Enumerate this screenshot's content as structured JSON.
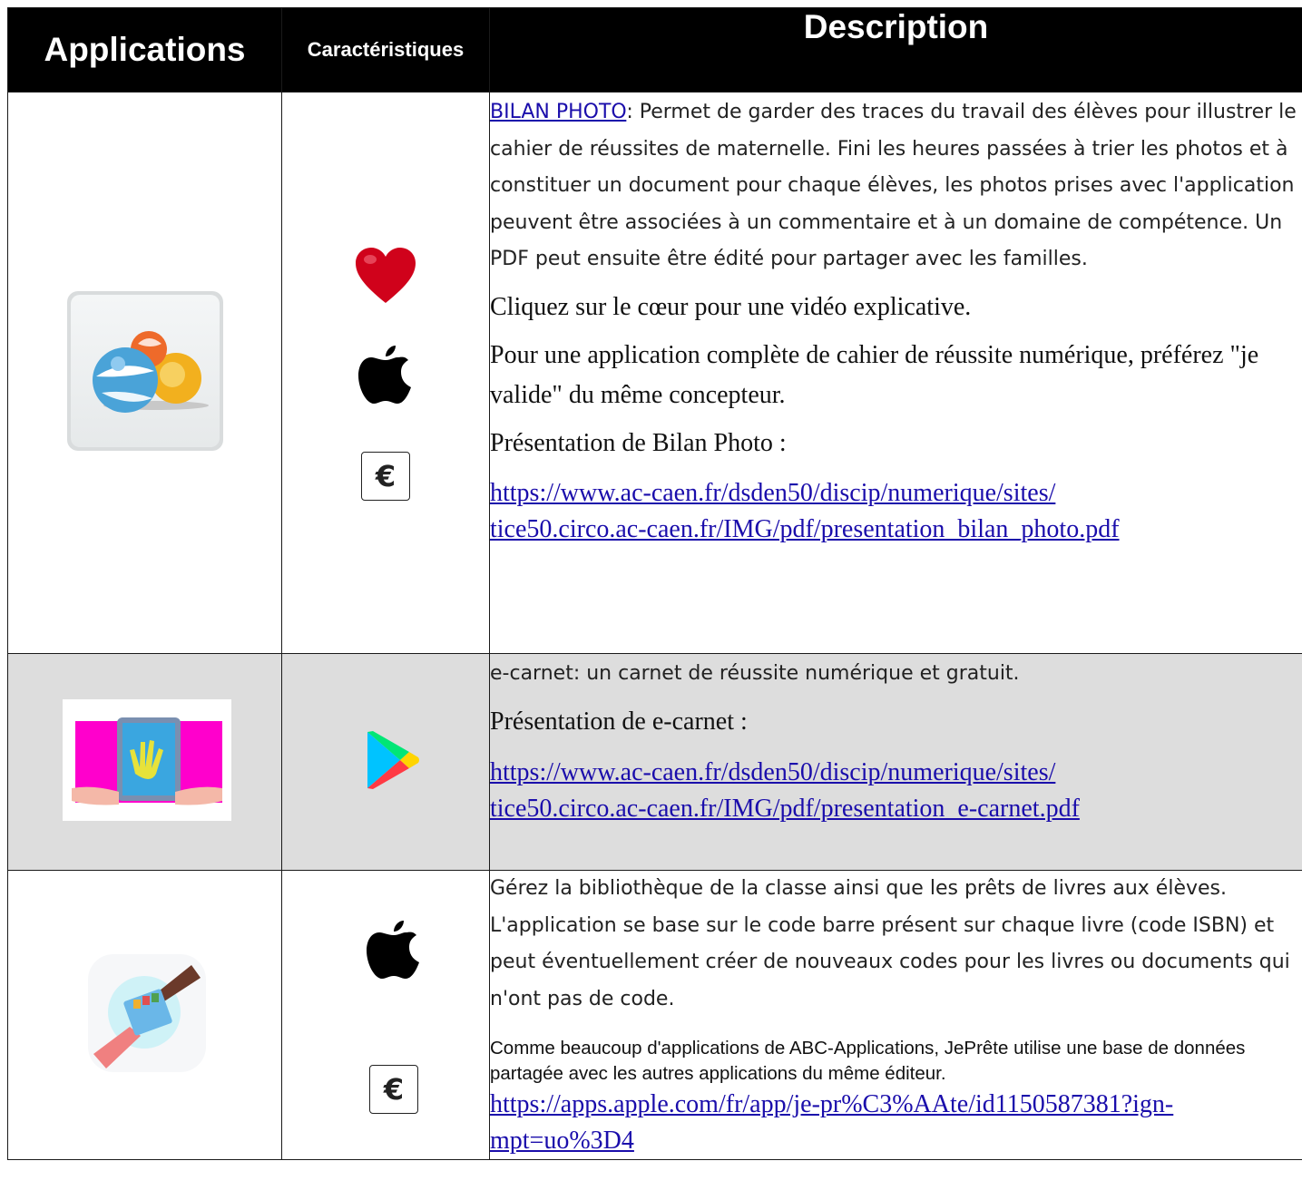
{
  "header": {
    "applications": "Applications",
    "caracteristiques": "Caractéristiques",
    "description": "Description"
  },
  "rows": [
    {
      "app_icon": "bilan-photo-app-icon",
      "characteristics": [
        "heart-icon",
        "apple-icon",
        "euro-icon"
      ],
      "euro_label": "€",
      "link_label": "BILAN PHOTO",
      "paragraph1": ": Permet de garder des traces du travail des élèves pour illustrer le cahier de réussites de maternelle. Fini les heures passées à trier les photos et à constituer un document pour chaque élèves, les photos prises avec l'application peuvent être associées à un commentaire et à un domaine de compétence. Un PDF peut ensuite être édité pour partager avec les familles.",
      "paragraph2": "Cliquez sur le cœur pour une vidéo explicative.",
      "paragraph3": "Pour une application complète de cahier de réussite numérique, préférez \"je valide\" du même concepteur.",
      "paragraph4": "Présentation de Bilan Photo :",
      "url_line1": "https://www.ac-caen.fr/dsden50/discip/numerique/sites/",
      "url_line2": "tice50.circo.ac-caen.fr/IMG/pdf/presentation_bilan_photo.pdf"
    },
    {
      "app_icon": "e-carnet-app-icon",
      "characteristics": [
        "google-play-icon"
      ],
      "paragraph1": "e-carnet: un carnet de réussite numérique et gratuit.",
      "paragraph2": "Présentation de e-carnet :",
      "url_line1": "https://www.ac-caen.fr/dsden50/discip/numerique/sites/",
      "url_line2": "tice50.circo.ac-caen.fr/IMG/pdf/presentation_e-carnet.pdf"
    },
    {
      "app_icon": "jeprete-app-icon",
      "characteristics": [
        "apple-icon",
        "euro-icon"
      ],
      "euro_label": "€",
      "paragraph1": "Gérez la bibliothèque de la classe ainsi que les prêts de livres aux élèves. L'application se base sur le code barre présent sur chaque livre (code ISBN) et peut éventuellement créer de nouveaux codes pour les livres ou documents qui n'ont pas de code.",
      "paragraph2": "Comme beaucoup d'applications de ABC-Applications, JePrête utilise une base de données partagée avec les autres applications du même éditeur.",
      "url_line1": "https://apps.apple.com/fr/app/je-pr%C3%AAte/id1150587381?ign-",
      "url_line2": "mpt=uo%3D4"
    }
  ],
  "colors": {
    "header_bg": "#000000",
    "row_alt_bg": "#dddddd",
    "link": "#1a0dab",
    "heart": "#d0021b",
    "ecarnet_bg": "#ff00cc"
  }
}
